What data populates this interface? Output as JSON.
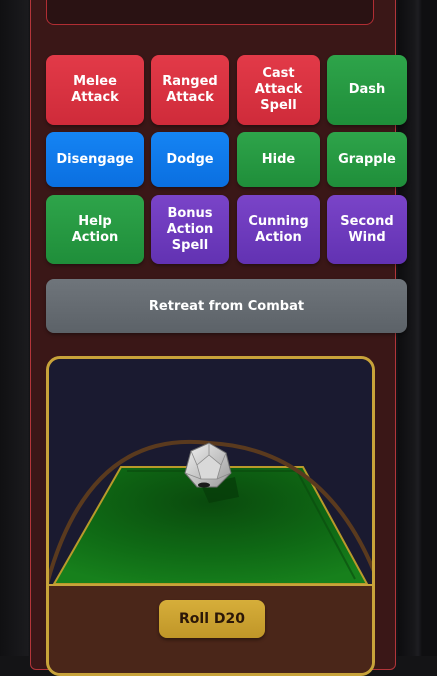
{
  "actions": {
    "row1": [
      {
        "label_lines": [
          "Melee",
          "Attack"
        ],
        "color": "#d92f3f"
      },
      {
        "label_lines": [
          "Ranged",
          "Attack"
        ],
        "color": "#d92f3f"
      },
      {
        "label_lines": [
          "Cast",
          "Attack",
          "Spell"
        ],
        "color": "#d92f3f"
      },
      {
        "label_lines": [
          "Dash"
        ],
        "color": "#27a044"
      }
    ],
    "row2": [
      {
        "label_lines": [
          "Disengage"
        ],
        "color": "#0f7aee"
      },
      {
        "label_lines": [
          "Dodge"
        ],
        "color": "#0f7aee"
      },
      {
        "label_lines": [
          "Hide"
        ],
        "color": "#27a044"
      },
      {
        "label_lines": [
          "Grapple"
        ],
        "color": "#27a044"
      }
    ],
    "row3": [
      {
        "label_lines": [
          "Help",
          "Action"
        ],
        "color": "#27a044"
      },
      {
        "label_lines": [
          "Bonus",
          "Action",
          "Spell"
        ],
        "color": "#6f3bbf"
      },
      {
        "label_lines": [
          "Cunning",
          "Action"
        ],
        "color": "#6f3bbf"
      },
      {
        "label_lines": [
          "Second",
          "Wind"
        ],
        "color": "#6f3bbf"
      }
    ]
  },
  "retreat": {
    "label": "Retreat from Combat",
    "color": "#666c72"
  },
  "dice": {
    "icon": "d20-icon",
    "roll_label": "Roll D20",
    "result_text": "",
    "accent": "#c8a33a",
    "table_color": "#0d5a12"
  }
}
